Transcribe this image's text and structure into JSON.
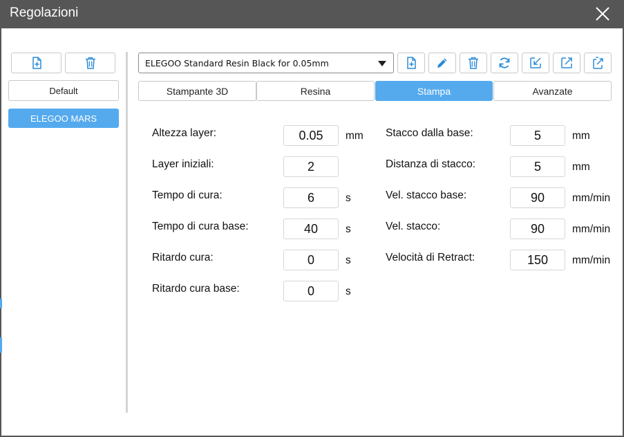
{
  "window": {
    "title": "Regolazioni"
  },
  "left": {
    "profiles": [
      {
        "label": "Default"
      },
      {
        "label": "ELEGOO MARS"
      }
    ]
  },
  "resin_profile": {
    "selected": "ELEGOO Standard Resin Black for 0.05mm"
  },
  "tabs": [
    {
      "label": "Stampante 3D"
    },
    {
      "label": "Resina"
    },
    {
      "label": "Stampa"
    },
    {
      "label": "Avanzate"
    }
  ],
  "settings_left": [
    {
      "label": "Altezza layer:",
      "value": "0.05",
      "unit": "mm"
    },
    {
      "label": "Layer iniziali:",
      "value": "2",
      "unit": ""
    },
    {
      "label": "Tempo di cura:",
      "value": "6",
      "unit": "s"
    },
    {
      "label": "Tempo di cura base:",
      "value": "40",
      "unit": "s"
    },
    {
      "label": "Ritardo cura:",
      "value": "0",
      "unit": "s"
    },
    {
      "label": "Ritardo cura base:",
      "value": "0",
      "unit": "s"
    }
  ],
  "settings_right": [
    {
      "label": "Stacco dalla base:",
      "value": "5",
      "unit": "mm"
    },
    {
      "label": "Distanza di stacco:",
      "value": "5",
      "unit": "mm"
    },
    {
      "label": "Vel. stacco base:",
      "value": "90",
      "unit": "mm/min"
    },
    {
      "label": "Vel. stacco:",
      "value": "90",
      "unit": "mm/min"
    },
    {
      "label": "Velocità di Retract:",
      "value": "150",
      "unit": "mm/min"
    }
  ],
  "colors": {
    "accent": "#55aaee",
    "titlebar": "#565656"
  },
  "icons": [
    "close-icon",
    "new-file-icon",
    "trash-icon",
    "pencil-icon",
    "refresh-icon",
    "import-icon",
    "export-icon",
    "export-all-icon"
  ]
}
